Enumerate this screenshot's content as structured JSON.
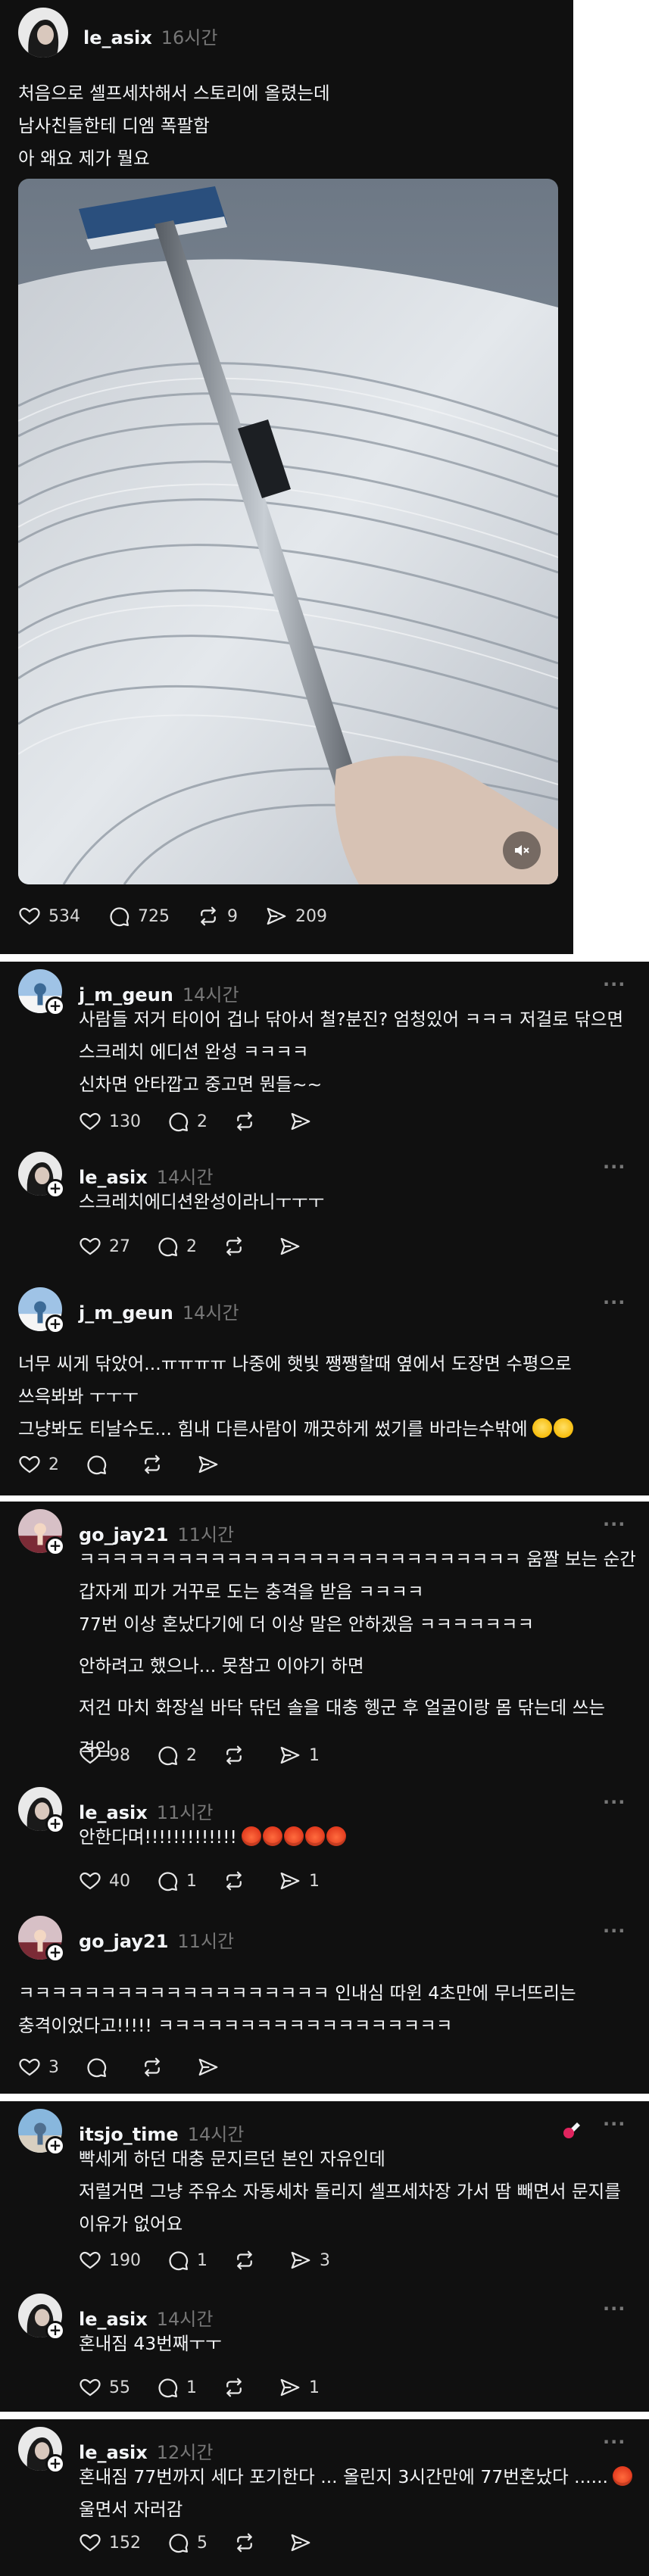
{
  "post": {
    "username": "le_asix",
    "time": "16시간",
    "lines": [
      "처음으로 셀프세차해서 스토리에 올렸는데",
      "남사친들한테 디엠 폭팔함",
      "아 왜요 제가 뭘요"
    ],
    "likes": "534",
    "comments": "725",
    "reposts": "9",
    "shares": "209"
  },
  "threads": [
    {
      "comments": [
        {
          "username": "j_m_geun",
          "time": "14시간",
          "lines": [
            "사람들 저거 타이어 겁나 닦아서 철?분진? 엄청있어 ㅋㅋㅋ 저걸로 닦으면",
            "스크레치 에디션 완성 ㅋㅋㅋㅋ",
            "신차면 안타깝고 중고면 뭔들~~"
          ],
          "likes": "130",
          "replies": "2",
          "reposts": "",
          "shares": ""
        },
        {
          "username": "le_asix",
          "time": "14시간",
          "lines": [
            "스크레치에디션완성이라니ㅜㅜㅜ"
          ],
          "likes": "27",
          "replies": "2",
          "reposts": "",
          "shares": ""
        },
        {
          "username": "j_m_geun",
          "time": "14시간",
          "lines": [
            "너무 씨게 닦았어...ㅠㅠㅠㅠ 나중에 햇빛 쨍쨍할때 옆에서 도장면 수평으로",
            "쓰윽봐봐 ㅜㅜㅜ",
            "그냥봐도 티날수도... 힘내 다른사람이 깨끗하게 썼기를 바라는수밖에"
          ],
          "likes": "2",
          "replies": "",
          "reposts": "",
          "shares": ""
        }
      ]
    },
    {
      "comments": [
        {
          "username": "go_jay21",
          "time": "11시간",
          "lines": [
            "ㅋㅋㅋㅋㅋㅋㅋㅋㅋㅋㅋㅋㅋㅋㅋㅋㅋㅋㅋㅋㅋㅋㅋㅋㅋㅋㅋ 움짤 보는 순간",
            "갑자게 피가 거꾸로 도는 충격을 받음 ㅋㅋㅋㅋ",
            "77번 이상 혼났다기에 더 이상 말은 안하겠음 ㅋㅋㅋㅋㅋㅋㅋ",
            "안하려고 했으나... 못참고 이야기 하면",
            "저건 마치 화장실 바닥 닦던 솔을 대충 헹군 후 얼굴이랑 몸 닦는데 쓰는",
            "격임"
          ],
          "likes": "98",
          "replies": "2",
          "reposts": "",
          "shares": "1"
        },
        {
          "username": "le_asix",
          "time": "11시간",
          "lines": [
            "안한다며!!!!!!!!!!!!!"
          ],
          "likes": "40",
          "replies": "1",
          "reposts": "",
          "shares": "1"
        },
        {
          "username": "go_jay21",
          "time": "11시간",
          "lines": [
            "ㅋㅋㅋㅋㅋㅋㅋㅋㅋㅋㅋㅋㅋㅋㅋㅋㅋㅋㅋ 인내심 따윈 4초만에 무너뜨리는",
            "충격이었다고!!!!! ㅋㅋㅋㅋㅋㅋㅋㅋㅋㅋㅋㅋㅋㅋㅋㅋㅋㅋ"
          ],
          "likes": "3",
          "replies": "",
          "reposts": "",
          "shares": ""
        }
      ]
    },
    {
      "comments": [
        {
          "username": "itsjo_time",
          "time": "14시간",
          "lines": [
            "빡세게 하던 대충 문지르던 본인 자유인데",
            "저럴거면 그냥 주유소 자동세차 돌리지 셀프세차장 가서 땀 빼면서 문지를",
            "이유가 없어요"
          ],
          "likes": "190",
          "replies": "1",
          "reposts": "",
          "shares": "3"
        },
        {
          "username": "le_asix",
          "time": "14시간",
          "lines": [
            "혼내짐 43번째ㅜㅜ"
          ],
          "likes": "55",
          "replies": "1",
          "reposts": "",
          "shares": "1"
        }
      ]
    },
    {
      "comments": [
        {
          "username": "le_asix",
          "time": "12시간",
          "lines": [
            "혼내짐 77번까지 세다 포기한다 ... 올린지 3시간만에 77번혼났다 ......",
            "울면서 자러감"
          ],
          "likes": "152",
          "replies": "5",
          "reposts": "",
          "shares": ""
        }
      ]
    }
  ],
  "icons": {
    "like": "heart-icon",
    "reply": "comment-icon",
    "repost": "repost-icon",
    "share": "send-icon",
    "more": "more-icon",
    "mute": "mute-icon"
  },
  "colors": {
    "background": "#101010",
    "text": "#f3f5f7",
    "muted": "#777777",
    "page_gap": "#ffffff"
  }
}
